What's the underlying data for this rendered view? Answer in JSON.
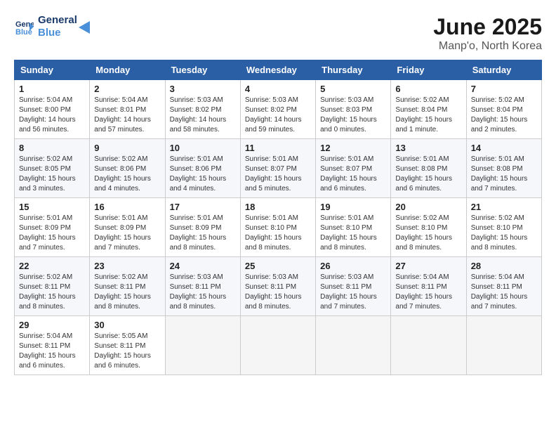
{
  "header": {
    "logo_line1": "General",
    "logo_line2": "Blue",
    "title": "June 2025",
    "subtitle": "Manp'o, North Korea"
  },
  "days_of_week": [
    "Sunday",
    "Monday",
    "Tuesday",
    "Wednesday",
    "Thursday",
    "Friday",
    "Saturday"
  ],
  "weeks": [
    [
      {
        "day": "1",
        "info": "Sunrise: 5:04 AM\nSunset: 8:00 PM\nDaylight: 14 hours\nand 56 minutes."
      },
      {
        "day": "2",
        "info": "Sunrise: 5:04 AM\nSunset: 8:01 PM\nDaylight: 14 hours\nand 57 minutes."
      },
      {
        "day": "3",
        "info": "Sunrise: 5:03 AM\nSunset: 8:02 PM\nDaylight: 14 hours\nand 58 minutes."
      },
      {
        "day": "4",
        "info": "Sunrise: 5:03 AM\nSunset: 8:02 PM\nDaylight: 14 hours\nand 59 minutes."
      },
      {
        "day": "5",
        "info": "Sunrise: 5:03 AM\nSunset: 8:03 PM\nDaylight: 15 hours\nand 0 minutes."
      },
      {
        "day": "6",
        "info": "Sunrise: 5:02 AM\nSunset: 8:04 PM\nDaylight: 15 hours\nand 1 minute."
      },
      {
        "day": "7",
        "info": "Sunrise: 5:02 AM\nSunset: 8:04 PM\nDaylight: 15 hours\nand 2 minutes."
      }
    ],
    [
      {
        "day": "8",
        "info": "Sunrise: 5:02 AM\nSunset: 8:05 PM\nDaylight: 15 hours\nand 3 minutes."
      },
      {
        "day": "9",
        "info": "Sunrise: 5:02 AM\nSunset: 8:06 PM\nDaylight: 15 hours\nand 4 minutes."
      },
      {
        "day": "10",
        "info": "Sunrise: 5:01 AM\nSunset: 8:06 PM\nDaylight: 15 hours\nand 4 minutes."
      },
      {
        "day": "11",
        "info": "Sunrise: 5:01 AM\nSunset: 8:07 PM\nDaylight: 15 hours\nand 5 minutes."
      },
      {
        "day": "12",
        "info": "Sunrise: 5:01 AM\nSunset: 8:07 PM\nDaylight: 15 hours\nand 6 minutes."
      },
      {
        "day": "13",
        "info": "Sunrise: 5:01 AM\nSunset: 8:08 PM\nDaylight: 15 hours\nand 6 minutes."
      },
      {
        "day": "14",
        "info": "Sunrise: 5:01 AM\nSunset: 8:08 PM\nDaylight: 15 hours\nand 7 minutes."
      }
    ],
    [
      {
        "day": "15",
        "info": "Sunrise: 5:01 AM\nSunset: 8:09 PM\nDaylight: 15 hours\nand 7 minutes."
      },
      {
        "day": "16",
        "info": "Sunrise: 5:01 AM\nSunset: 8:09 PM\nDaylight: 15 hours\nand 7 minutes."
      },
      {
        "day": "17",
        "info": "Sunrise: 5:01 AM\nSunset: 8:09 PM\nDaylight: 15 hours\nand 8 minutes."
      },
      {
        "day": "18",
        "info": "Sunrise: 5:01 AM\nSunset: 8:10 PM\nDaylight: 15 hours\nand 8 minutes."
      },
      {
        "day": "19",
        "info": "Sunrise: 5:01 AM\nSunset: 8:10 PM\nDaylight: 15 hours\nand 8 minutes."
      },
      {
        "day": "20",
        "info": "Sunrise: 5:02 AM\nSunset: 8:10 PM\nDaylight: 15 hours\nand 8 minutes."
      },
      {
        "day": "21",
        "info": "Sunrise: 5:02 AM\nSunset: 8:10 PM\nDaylight: 15 hours\nand 8 minutes."
      }
    ],
    [
      {
        "day": "22",
        "info": "Sunrise: 5:02 AM\nSunset: 8:11 PM\nDaylight: 15 hours\nand 8 minutes."
      },
      {
        "day": "23",
        "info": "Sunrise: 5:02 AM\nSunset: 8:11 PM\nDaylight: 15 hours\nand 8 minutes."
      },
      {
        "day": "24",
        "info": "Sunrise: 5:03 AM\nSunset: 8:11 PM\nDaylight: 15 hours\nand 8 minutes."
      },
      {
        "day": "25",
        "info": "Sunrise: 5:03 AM\nSunset: 8:11 PM\nDaylight: 15 hours\nand 8 minutes."
      },
      {
        "day": "26",
        "info": "Sunrise: 5:03 AM\nSunset: 8:11 PM\nDaylight: 15 hours\nand 7 minutes."
      },
      {
        "day": "27",
        "info": "Sunrise: 5:04 AM\nSunset: 8:11 PM\nDaylight: 15 hours\nand 7 minutes."
      },
      {
        "day": "28",
        "info": "Sunrise: 5:04 AM\nSunset: 8:11 PM\nDaylight: 15 hours\nand 7 minutes."
      }
    ],
    [
      {
        "day": "29",
        "info": "Sunrise: 5:04 AM\nSunset: 8:11 PM\nDaylight: 15 hours\nand 6 minutes."
      },
      {
        "day": "30",
        "info": "Sunrise: 5:05 AM\nSunset: 8:11 PM\nDaylight: 15 hours\nand 6 minutes."
      },
      {
        "day": "",
        "info": ""
      },
      {
        "day": "",
        "info": ""
      },
      {
        "day": "",
        "info": ""
      },
      {
        "day": "",
        "info": ""
      },
      {
        "day": "",
        "info": ""
      }
    ]
  ]
}
